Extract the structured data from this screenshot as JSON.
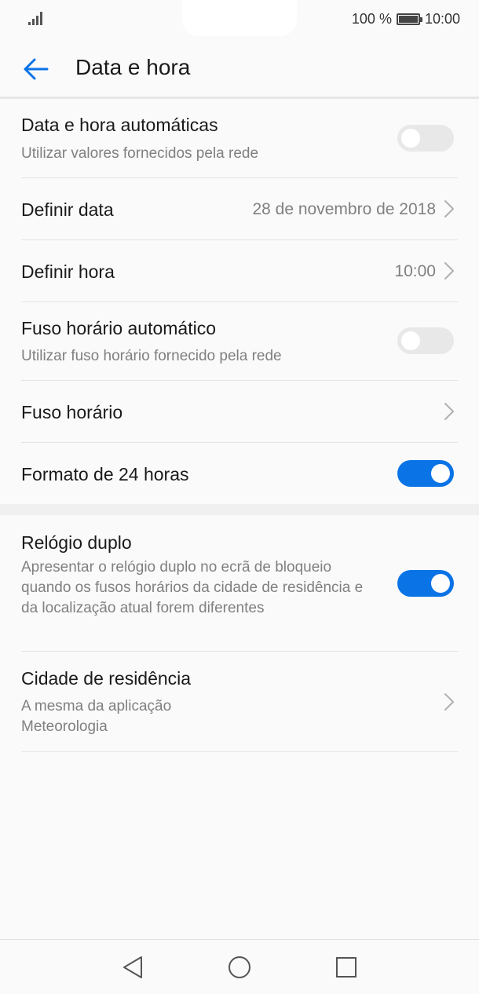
{
  "status": {
    "battery_text": "100 %",
    "time": "10:00"
  },
  "header": {
    "title": "Data e hora"
  },
  "settings": {
    "auto_datetime": {
      "title": "Data e hora automáticas",
      "subtitle": "Utilizar valores fornecidos pela rede",
      "enabled": false
    },
    "set_date": {
      "title": "Definir data",
      "value": "28 de novembro de 2018"
    },
    "set_time": {
      "title": "Definir hora",
      "value": "10:00"
    },
    "auto_timezone": {
      "title": "Fuso horário automático",
      "subtitle": "Utilizar fuso horário fornecido pela rede",
      "enabled": false
    },
    "timezone": {
      "title": "Fuso horário"
    },
    "format_24h": {
      "title": "Formato de 24 horas",
      "enabled": true
    },
    "dual_clock": {
      "title": "Relógio duplo",
      "subtitle": "Apresentar o relógio duplo no ecrã de bloqueio quando os fusos horários da cidade de residência e da localização atual forem diferentes",
      "enabled": true
    },
    "home_city": {
      "title": "Cidade de residência",
      "subtitle": "A mesma da aplicação Meteorologia"
    }
  },
  "colors": {
    "accent": "#0a73e6",
    "toggle_off": "#e8e8e8",
    "secondary_text": "#808080"
  },
  "icons": {
    "back": "arrow-left-icon",
    "chevron": "chevron-right-icon",
    "nav_back": "triangle-back-icon",
    "nav_home": "circle-home-icon",
    "nav_recents": "square-recents-icon"
  }
}
